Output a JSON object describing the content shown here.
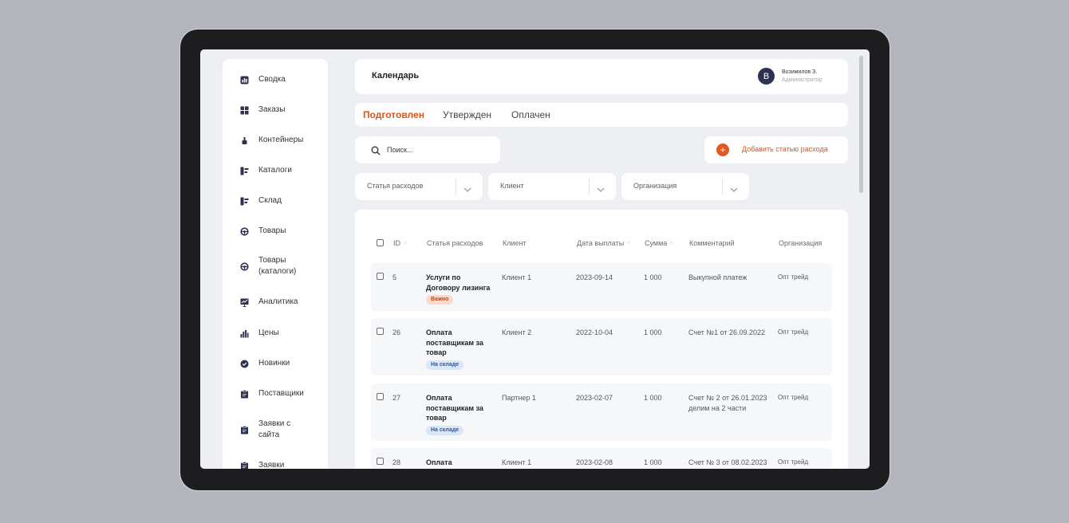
{
  "sidebar": {
    "items": [
      {
        "label": "Сводка",
        "icon": "dashboard-icon"
      },
      {
        "label": "Заказы",
        "icon": "grid-icon"
      },
      {
        "label": "Контейнеры",
        "icon": "container-icon"
      },
      {
        "label": "Каталоги",
        "icon": "catalog-icon"
      },
      {
        "label": "Склад",
        "icon": "warehouse-icon"
      },
      {
        "label": "Товары",
        "icon": "wheel-icon"
      },
      {
        "label": "Товары\n(каталоги)",
        "icon": "wheel-icon"
      },
      {
        "label": "Аналитика",
        "icon": "analytics-icon"
      },
      {
        "label": "Цены",
        "icon": "bar-chart-icon"
      },
      {
        "label": "Новинки",
        "icon": "badge-check-icon"
      },
      {
        "label": "Поставщики",
        "icon": "clipboard-icon"
      },
      {
        "label": "Заявки с\nсайта",
        "icon": "clipboard-icon"
      },
      {
        "label": "Заявки",
        "icon": "clipboard-icon"
      }
    ]
  },
  "header": {
    "title": "Календарь",
    "user": {
      "initial": "В",
      "name": "Возимилов З.",
      "role": "Администратор"
    }
  },
  "tabs": [
    {
      "label": "Подготовлен",
      "active": true
    },
    {
      "label": "Утвержден",
      "active": false
    },
    {
      "label": "Оплачен",
      "active": false
    }
  ],
  "search": {
    "placeholder": "Поиск..."
  },
  "add_button": {
    "label": "Добавить статью расхода",
    "icon": "plus-icon"
  },
  "filters": [
    {
      "label": "Статья расходов"
    },
    {
      "label": "Клиент"
    },
    {
      "label": "Организация"
    }
  ],
  "table": {
    "columns": [
      "ID",
      "Статья расходов",
      "Клиент",
      "Дата выплаты",
      "Сумма",
      "Комментарий",
      "Организация"
    ],
    "rows": [
      {
        "id": "5",
        "title": "Услуги по Договору лизинга",
        "badge": "Важно",
        "badge_type": "important",
        "client": "Клиент 1",
        "date": "2023-09-14",
        "sum": "1 000",
        "comment": "Выкупной платеж",
        "org": "Опт трейд"
      },
      {
        "id": "26",
        "title": "Оплата поставщикам за товар",
        "badge": "На складе",
        "badge_type": "stock",
        "client": "Клиент 2",
        "date": "2022-10-04",
        "sum": "1 000",
        "comment": "Счет №1 от 26.09.2022",
        "org": "Опт трейд"
      },
      {
        "id": "27",
        "title": "Оплата поставщикам за товар",
        "badge": "На складе",
        "badge_type": "stock",
        "client": "Партнер 1",
        "date": "2023-02-07",
        "sum": "1 000",
        "comment": "Счет № 2 от 26.01.2023 делим на 2 части",
        "org": "Опт трейд"
      },
      {
        "id": "28",
        "title": "Оплата",
        "badge": "",
        "badge_type": "",
        "client": "Клиент 1",
        "date": "2023-02-08",
        "sum": "1 000",
        "comment": "Счет № 3 от 08.02.2023",
        "org": "Опт трейд"
      }
    ]
  },
  "colors": {
    "accent": "#d9541c",
    "badge_important_bg": "#fbd9cc",
    "badge_important_fg": "#c2471a",
    "badge_stock_bg": "#dbe6f6",
    "badge_stock_fg": "#2f5a94",
    "avatar": "#2e3152"
  }
}
